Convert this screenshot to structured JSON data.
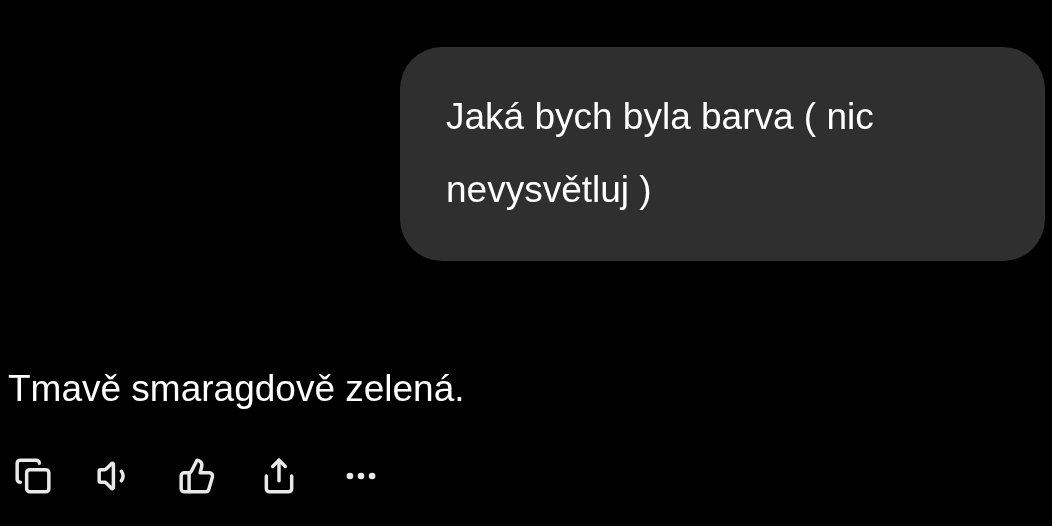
{
  "user_message": {
    "text": "Jaká bych byla barva ( nic nevysvětluj )"
  },
  "assistant_message": {
    "text": "Tmavě smaragdově zelená."
  }
}
